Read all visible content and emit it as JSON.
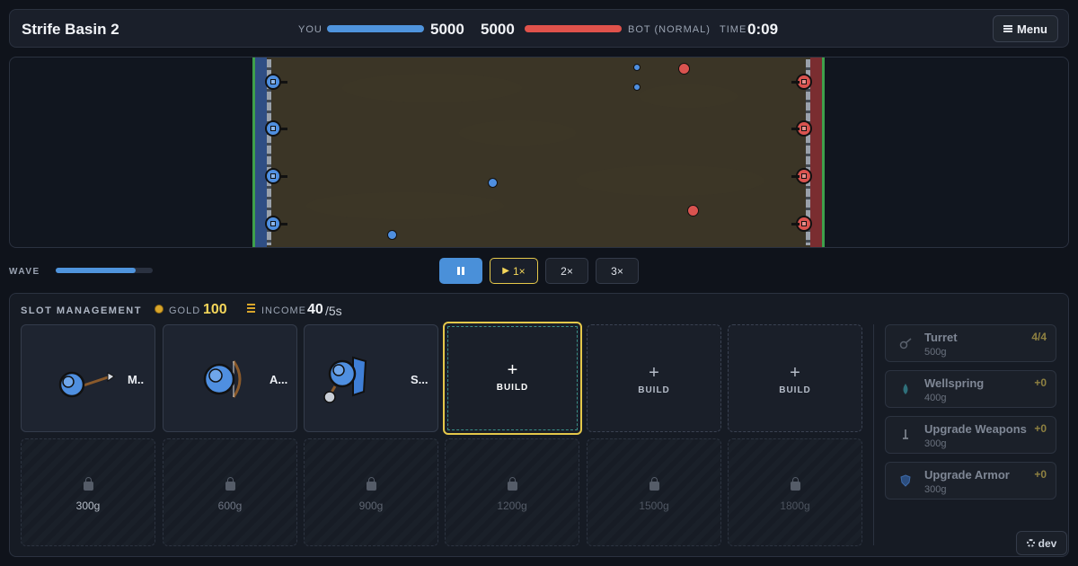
{
  "header": {
    "title": "Strife Basin 2",
    "you_label": "YOU",
    "you_hp": "5000",
    "bot_hp": "5000",
    "bot_label": "BOT (NORMAL)",
    "time_label": "TIME",
    "time_value": "0:09",
    "menu_label": "Menu"
  },
  "wave": {
    "label": "WAVE",
    "progress_percent": 82
  },
  "controls": {
    "speed1_label": "1×",
    "speed2_label": "2×",
    "speed3_label": "3×",
    "active_speed": "1×"
  },
  "slots_panel": {
    "title": "SLOT MANAGEMENT",
    "gold_label": "GOLD",
    "gold_value": "100",
    "income_label": "INCOME",
    "income_value": "40",
    "income_unit": "/5s",
    "unit_slots": [
      {
        "name": "M..",
        "icon": "spear-unit-icon"
      },
      {
        "name": "A...",
        "icon": "archer-unit-icon"
      },
      {
        "name": "S...",
        "icon": "shield-mace-unit-icon"
      }
    ],
    "build_slots": [
      {
        "label": "BUILD"
      },
      {
        "label": "BUILD"
      },
      {
        "label": "BUILD"
      }
    ],
    "locked_slots": [
      {
        "price": "300g"
      },
      {
        "price": "600g"
      },
      {
        "price": "900g"
      },
      {
        "price": "1200g"
      },
      {
        "price": "1500g"
      },
      {
        "price": "1800g"
      }
    ]
  },
  "upgrades": [
    {
      "name": "Turret",
      "cost": "500g",
      "badge": "4/4",
      "icon": "turret-icon"
    },
    {
      "name": "Wellspring",
      "cost": "400g",
      "badge": "+0",
      "icon": "water-drop-icon"
    },
    {
      "name": "Upgrade Weapons",
      "cost": "300g",
      "badge": "+0",
      "icon": "sword-icon"
    },
    {
      "name": "Upgrade Armor",
      "cost": "300g",
      "badge": "+0",
      "icon": "shield-icon"
    }
  ],
  "dev_label": "dev",
  "colors": {
    "player": "#4f94dd",
    "bot": "#e0524b",
    "gold": "#f4d65a",
    "panel": "#161b24"
  }
}
